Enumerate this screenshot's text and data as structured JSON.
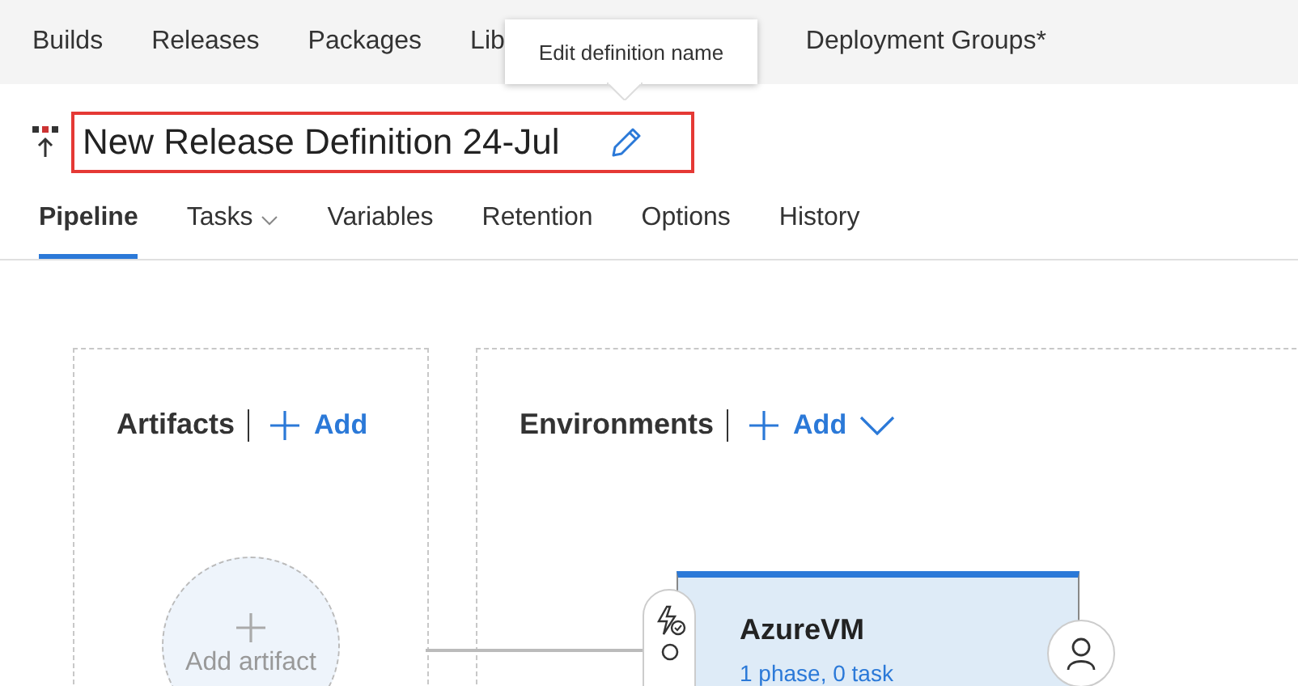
{
  "nav": {
    "items": [
      {
        "label": "Builds"
      },
      {
        "label": "Releases"
      },
      {
        "label": "Packages"
      },
      {
        "label": "Lib"
      },
      {
        "label": "Deployment Groups*"
      }
    ]
  },
  "tooltip": {
    "text": "Edit definition name"
  },
  "definition": {
    "name": "New Release Definition 24-Jul"
  },
  "tabs": [
    {
      "label": "Pipeline",
      "selected": true,
      "dropdown": false
    },
    {
      "label": "Tasks",
      "selected": false,
      "dropdown": true
    },
    {
      "label": "Variables",
      "selected": false,
      "dropdown": false
    },
    {
      "label": "Retention",
      "selected": false,
      "dropdown": false
    },
    {
      "label": "Options",
      "selected": false,
      "dropdown": false
    },
    {
      "label": "History",
      "selected": false,
      "dropdown": false
    }
  ],
  "artifacts": {
    "title": "Artifacts",
    "add": "Add",
    "node": {
      "label": "Add artifact"
    }
  },
  "environments": {
    "title": "Environments",
    "add": "Add",
    "cards": [
      {
        "name": "AzureVM",
        "summary": "1 phase, 0 task"
      }
    ]
  }
}
